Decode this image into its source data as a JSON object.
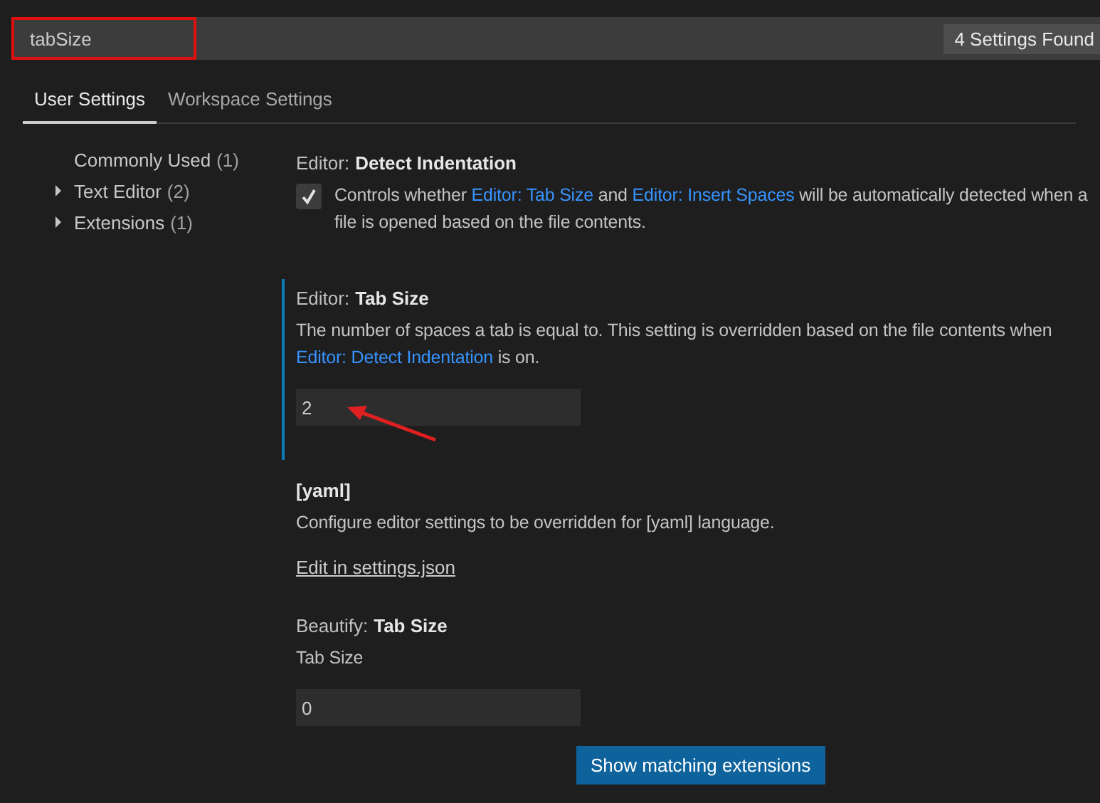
{
  "search": {
    "value": "tabSize",
    "highlighted": true,
    "count": "4 Settings Found"
  },
  "tabs": [
    {
      "label": "User Settings",
      "selected": true
    },
    {
      "label": "Workspace Settings",
      "selected": false
    }
  ],
  "sidebar": {
    "items": [
      {
        "label": "Commonly Used",
        "count": "(1)",
        "kind": "leaf"
      },
      {
        "label": "Text Editor",
        "count": "(2)",
        "kind": "group",
        "expanded": false
      },
      {
        "label": "Extensions",
        "count": "(1)",
        "kind": "group",
        "expanded": false
      }
    ]
  },
  "settings": [
    {
      "kind": "checkbox",
      "category": "Editor:",
      "name": "Detect Indentation",
      "checked": true,
      "focused": false,
      "description": [
        {
          "text": "Controls whether "
        },
        {
          "text": "Editor: Tab Size",
          "link": true
        },
        {
          "text": " and "
        },
        {
          "text": "Editor: Insert Spaces",
          "link": true
        },
        {
          "text": " will be automatically detected when a file is opened based on the file contents."
        }
      ]
    },
    {
      "kind": "number",
      "category": "Editor:",
      "name": "Tab Size",
      "value": "2",
      "focused": true,
      "annotated": true,
      "description": [
        {
          "text": "The number of spaces a tab is equal to. This setting is overridden based on the file contents when "
        },
        {
          "text": "Editor: Detect Indentation",
          "link": true
        },
        {
          "text": " is on."
        }
      ]
    },
    {
      "kind": "link",
      "name": "[yaml]",
      "focused": false,
      "link_label": "Edit in settings.json",
      "description": [
        {
          "text": "Configure editor settings to be overridden for [yaml] language."
        }
      ]
    },
    {
      "kind": "number",
      "category": "Beautify:",
      "name": "Tab Size",
      "value": "0",
      "focused": false,
      "annotated": false,
      "description": [
        {
          "text": "Tab Size"
        }
      ]
    }
  ],
  "footer_button": "Show matching extensions"
}
